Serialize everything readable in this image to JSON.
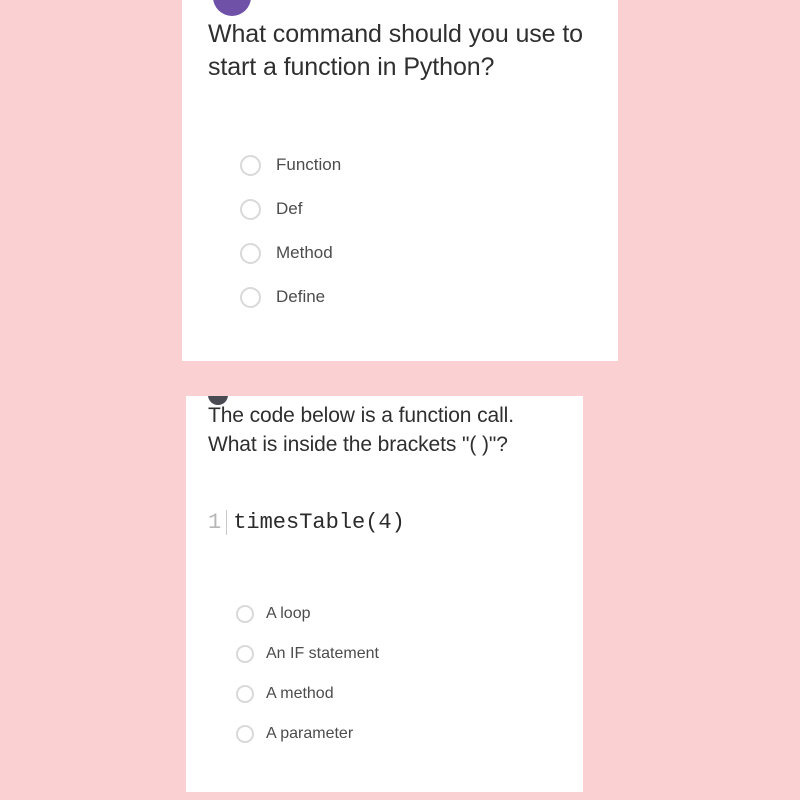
{
  "background_color": "#fbd0d2",
  "cards": [
    {
      "id": "card-one",
      "avatar": {
        "icon": "user-avatar-circle",
        "color": "#6f52a8"
      },
      "question": "What command should you use to start a function in Python?",
      "options": [
        {
          "label": "Function",
          "selected": false
        },
        {
          "label": "Def",
          "selected": false
        },
        {
          "label": "Method",
          "selected": false
        },
        {
          "label": "Define",
          "selected": false
        }
      ]
    },
    {
      "id": "card-two",
      "avatar": {
        "icon": "user-avatar-circle",
        "color": "#4a4a52"
      },
      "question": "The code below is a function call. What is inside the brackets \"( )\"?",
      "code": {
        "line_number": "1",
        "text": "timesTable(4)"
      },
      "options": [
        {
          "label": "A loop",
          "selected": false
        },
        {
          "label": "An IF statement",
          "selected": false
        },
        {
          "label": "A method",
          "selected": false
        },
        {
          "label": "A parameter",
          "selected": false
        }
      ]
    }
  ]
}
